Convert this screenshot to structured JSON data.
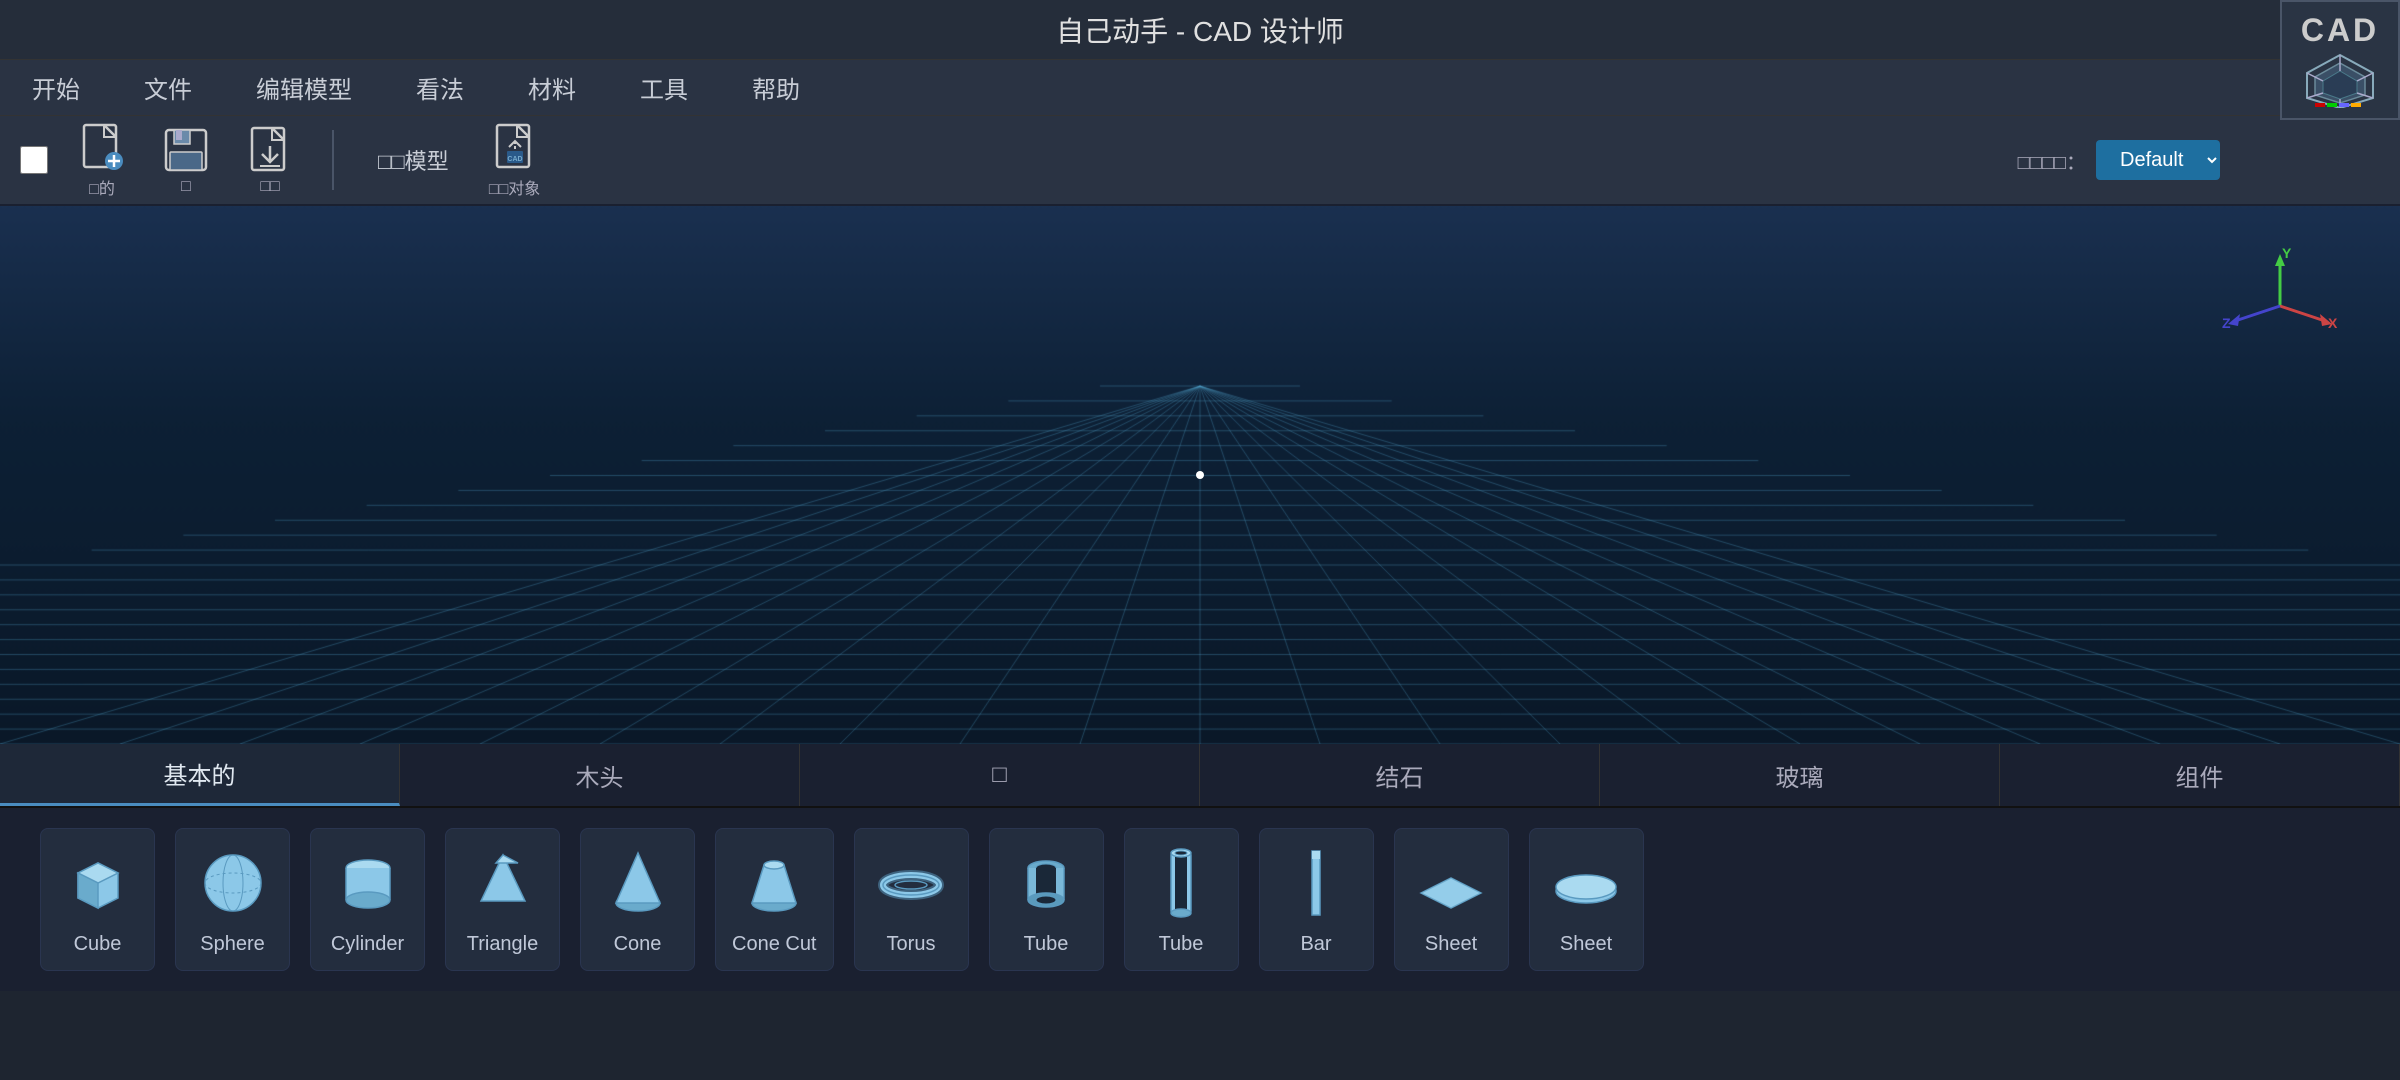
{
  "app": {
    "title": "自己动手 - CAD 设计师",
    "logo_text": "CAD"
  },
  "menu": {
    "items": [
      "开始",
      "文件",
      "编辑模型",
      "看法",
      "材料",
      "工具",
      "帮助"
    ]
  },
  "toolbar": {
    "checkbox_label": "",
    "new_label": "□的",
    "save_label": "□",
    "download_label": "□□",
    "section_label": "□□模型",
    "import_label": "□□对象"
  },
  "workspace": {
    "label": "□□□□：",
    "dropdown": "Default"
  },
  "nav_tabs": {
    "items": [
      "基本的",
      "木头",
      "□",
      "结石",
      "玻璃",
      "组件"
    ]
  },
  "shapes": [
    {
      "id": "cube",
      "label": "Cube",
      "type": "cube"
    },
    {
      "id": "sphere",
      "label": "Sphere",
      "type": "sphere"
    },
    {
      "id": "cylinder",
      "label": "Cylinder",
      "type": "cylinder"
    },
    {
      "id": "triangle",
      "label": "Triangle",
      "type": "triangle"
    },
    {
      "id": "cone",
      "label": "Cone",
      "type": "cone"
    },
    {
      "id": "cone-cut",
      "label": "Cone Cut",
      "type": "cone-cut"
    },
    {
      "id": "torus",
      "label": "Torus",
      "type": "torus"
    },
    {
      "id": "tube1",
      "label": "Tube",
      "type": "tube"
    },
    {
      "id": "tube2",
      "label": "Tube",
      "type": "tube-bar"
    },
    {
      "id": "bar",
      "label": "Bar",
      "type": "bar"
    },
    {
      "id": "sheet1",
      "label": "Sheet",
      "type": "sheet"
    },
    {
      "id": "sheet2",
      "label": "Sheet",
      "type": "sheet-flat"
    }
  ],
  "colors": {
    "background": "#0d1520",
    "grid_line": "#4a8caf",
    "accent": "#4a8cbf",
    "shape_fill": "#b8d8f0",
    "shape_dark": "#7ab0d8"
  }
}
